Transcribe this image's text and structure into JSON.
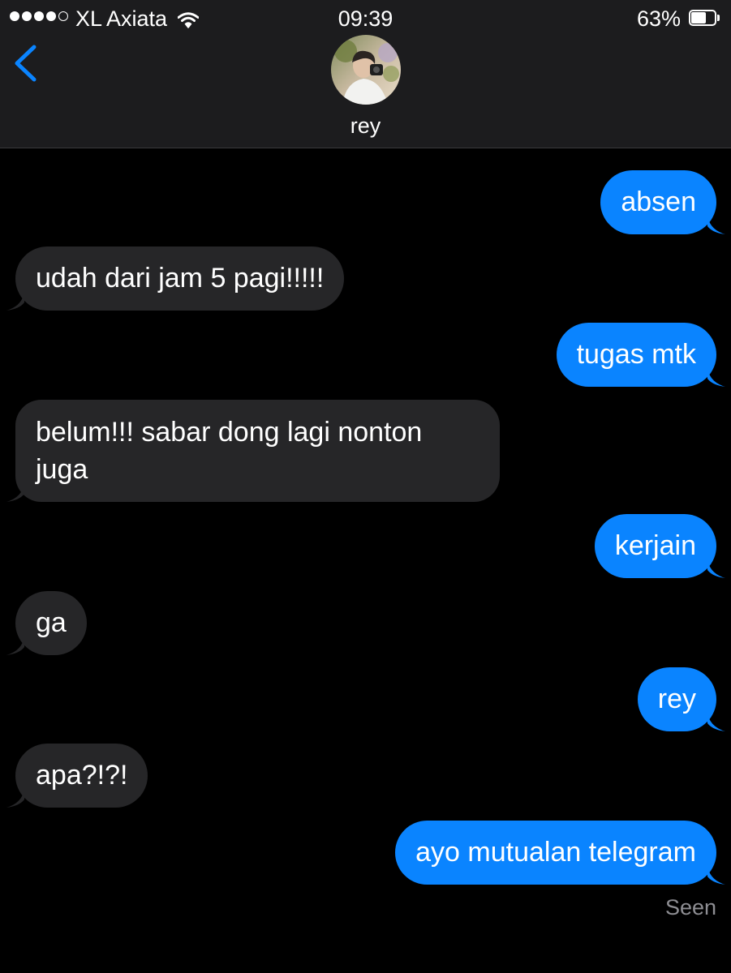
{
  "status_bar": {
    "carrier": "XL Axiata",
    "signal_bars": 4,
    "signal_max": 5,
    "time": "09:39",
    "battery_percent": "63%",
    "battery_level": 0.63
  },
  "header": {
    "contact_name": "rey",
    "back_icon": "chevron-left-icon",
    "accent": "#0a84ff"
  },
  "messages": [
    {
      "side": "sent",
      "text": "absen"
    },
    {
      "side": "received",
      "text": "udah dari jam 5 pagi!!!!!"
    },
    {
      "side": "sent",
      "text": "tugas mtk"
    },
    {
      "side": "received",
      "text": "belum!!! sabar dong lagi nonton juga"
    },
    {
      "side": "sent",
      "text": "kerjain"
    },
    {
      "side": "received",
      "text": "ga"
    },
    {
      "side": "sent",
      "text": "rey"
    },
    {
      "side": "received",
      "text": "apa?!?!"
    },
    {
      "side": "sent",
      "text": "ayo mutualan telegram"
    }
  ],
  "seen_label": "Seen",
  "colors": {
    "sent_bubble": "#0a84ff",
    "received_bubble": "#262628",
    "background": "#000000",
    "header_background": "#1c1c1e"
  }
}
